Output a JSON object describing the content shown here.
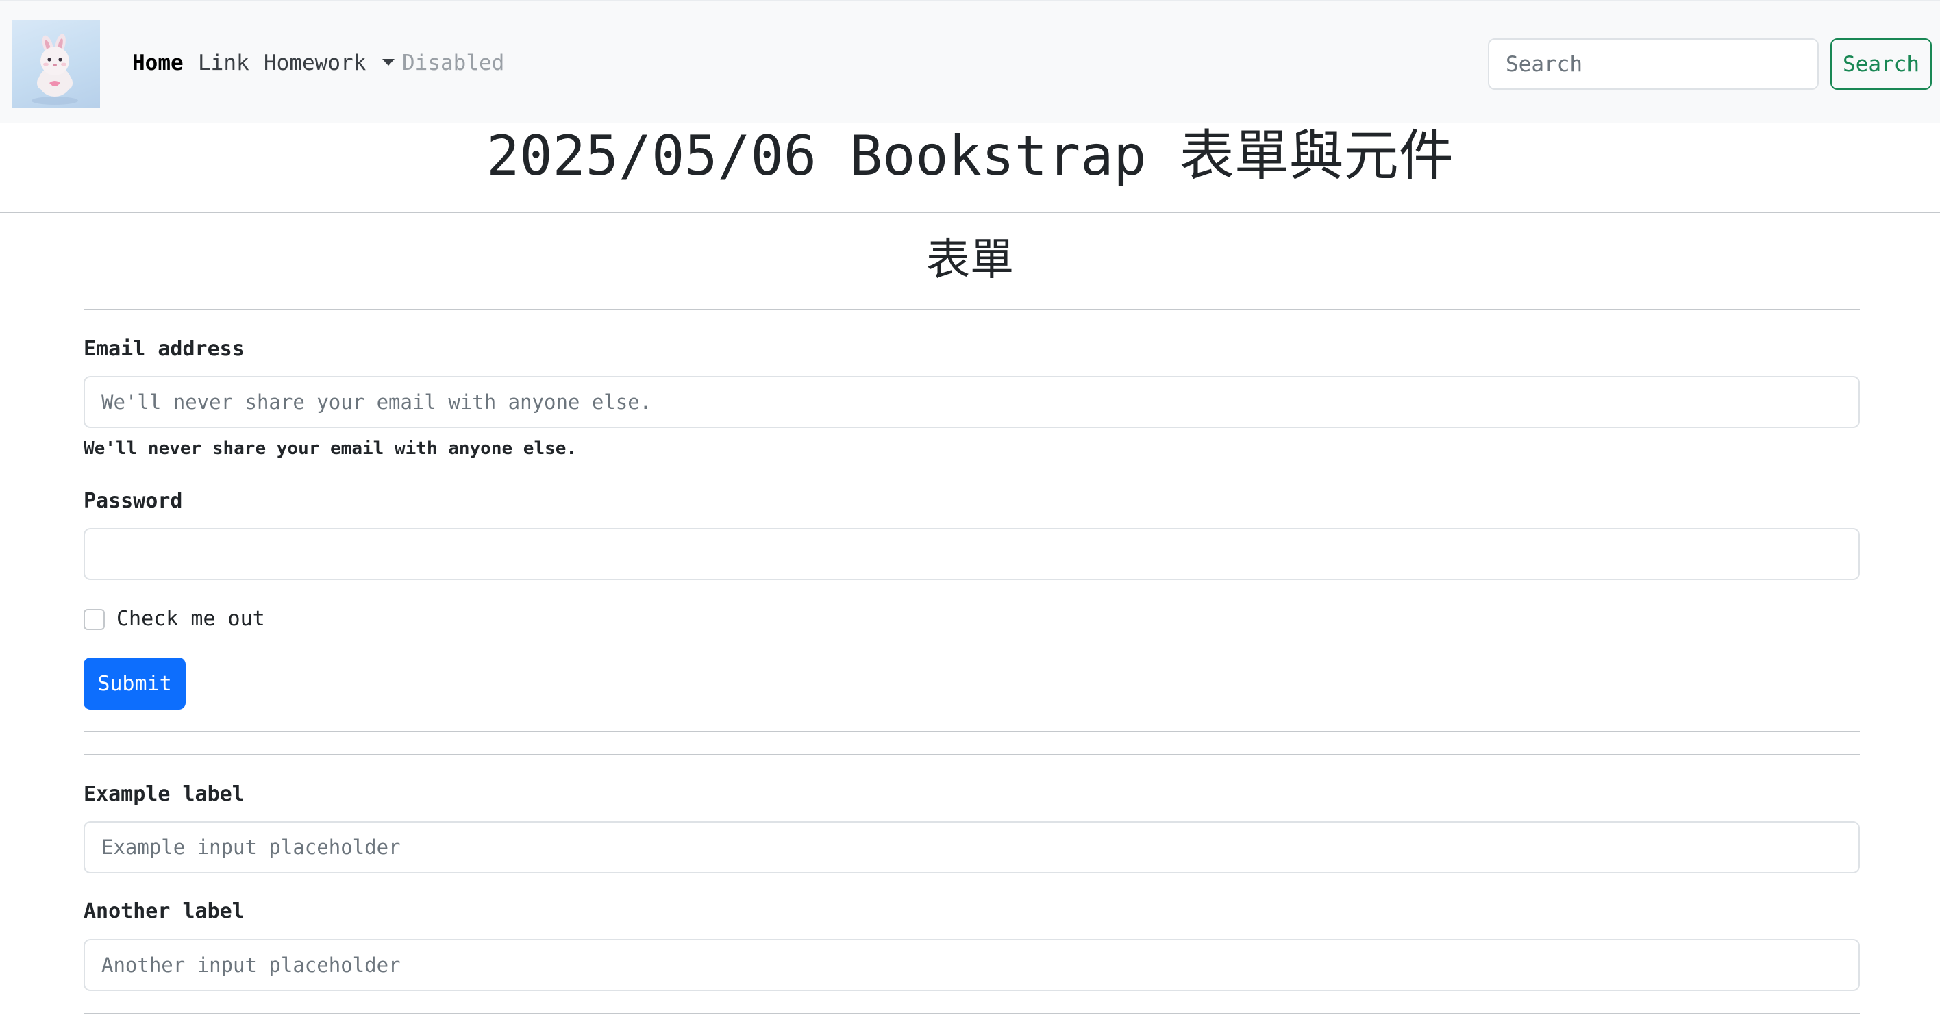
{
  "navbar": {
    "logo_alt": "bunny plush logo",
    "links": [
      {
        "label": "Home",
        "state": "active"
      },
      {
        "label": "Link",
        "state": "normal"
      },
      {
        "label": "Homework",
        "state": "dropdown"
      },
      {
        "label": "Disabled",
        "state": "disabled"
      }
    ],
    "search": {
      "placeholder": "Search",
      "button_label": "Search"
    }
  },
  "page": {
    "title": "2025/05/06 Bookstrap 表單與元件",
    "section_title": "表單"
  },
  "form": {
    "email_label": "Email address",
    "email_placeholder": "We'll never share your email with anyone else.",
    "email_help": "We'll never share your email with anyone else.",
    "password_label": "Password",
    "password_value": "",
    "checkbox_label": "Check me out",
    "checkbox_checked": false,
    "submit_label": "Submit"
  },
  "floating_form": {
    "example_label": "Example label",
    "example_placeholder": "Example input placeholder",
    "another_label": "Another label",
    "another_placeholder": "Another input placeholder"
  },
  "colors": {
    "navbar_bg": "#f8f9fa",
    "primary": "#0d6efd",
    "success": "#198754",
    "muted": "#6c757d"
  }
}
